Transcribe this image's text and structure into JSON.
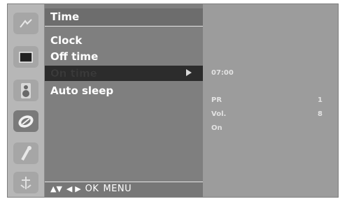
{
  "menu": {
    "title": "Time",
    "items": [
      {
        "label": "Clock",
        "selected": false
      },
      {
        "label": "Off time",
        "selected": false
      },
      {
        "label": "On time",
        "selected": true
      },
      {
        "label": "Auto sleep",
        "selected": false
      }
    ],
    "footer": {
      "updown": "▲▼",
      "leftright": "◀ ▶",
      "ok": "OK",
      "menu": "MENU"
    }
  },
  "sidebar": {
    "icons": [
      "picture-icon",
      "screen-icon",
      "sound-icon",
      "time-icon",
      "special-icon",
      "setup-icon"
    ],
    "active": "time-icon"
  },
  "detail": {
    "time": "07:00",
    "pr_label": "PR",
    "pr_value": "1",
    "vol_label": "Vol.",
    "vol_value": "8",
    "state": "On"
  },
  "colors": {
    "menu_bg": "#7f7f7f",
    "selected_bg": "#2c2c2c",
    "detail_bg": "#9c9c9c",
    "text": "#ffffff"
  }
}
